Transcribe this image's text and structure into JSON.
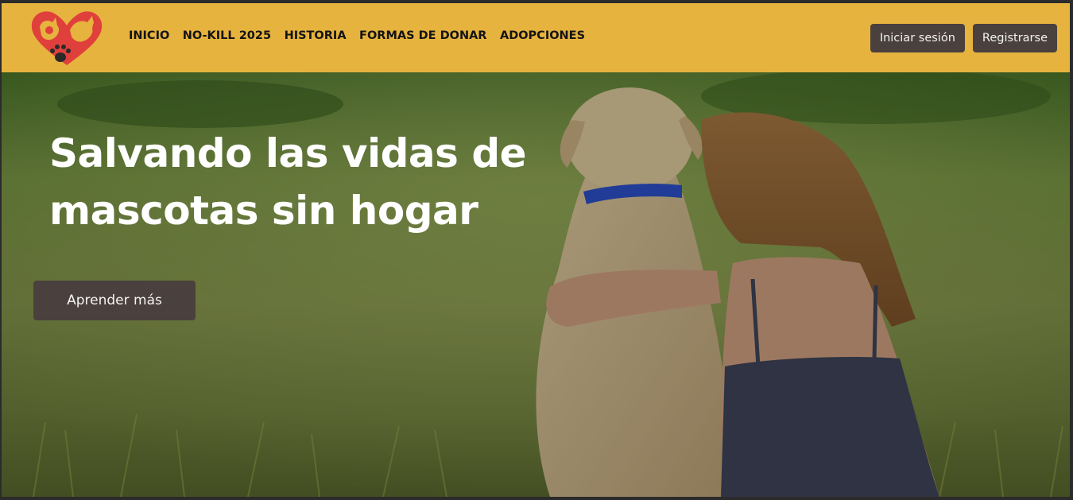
{
  "brand": {
    "logo_icon": "heart-cat-dog-paw-logo",
    "logo_color": "#e0403c"
  },
  "nav": {
    "links": [
      {
        "label": "INICIO"
      },
      {
        "label": "NO-KILL 2025"
      },
      {
        "label": "HISTORIA"
      },
      {
        "label": "FORMAS DE DONAR"
      },
      {
        "label": "ADOPCIONES"
      }
    ],
    "login_label": "Iniciar sesión",
    "register_label": "Registrarse"
  },
  "hero": {
    "title_line1": "Salvando las vidas de",
    "title_line2": "mascotas sin hogar",
    "cta_label": "Aprender más",
    "image": "girl-hugging-dog-in-grass-photo"
  },
  "colors": {
    "navbar_bg": "#e6b33e",
    "button_bg": "#4a403d",
    "button_text": "#f2f2f2",
    "nav_text": "#141414"
  }
}
